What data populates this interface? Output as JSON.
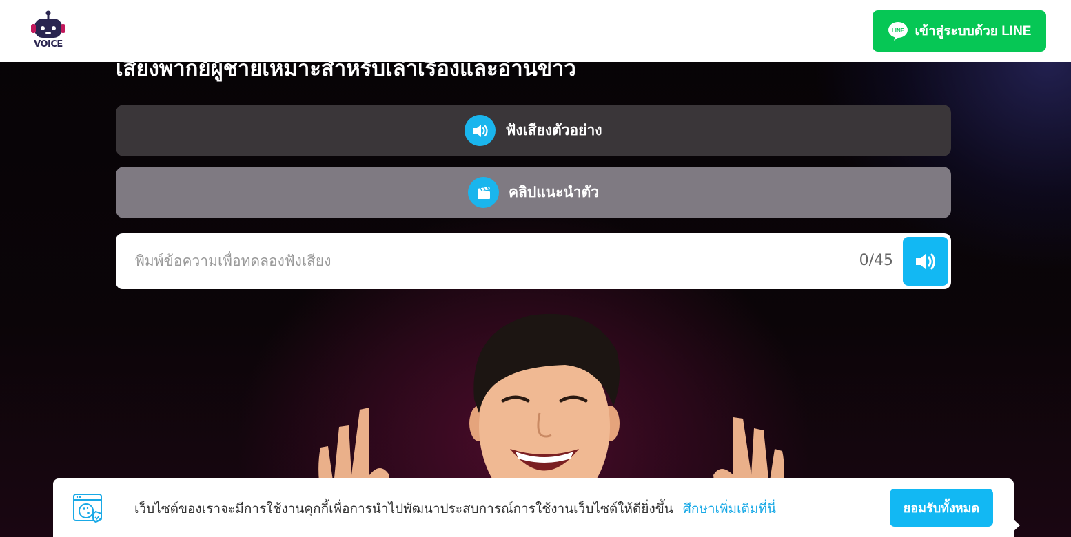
{
  "header": {
    "logo_text": "VOICE",
    "login_button_label": "เข้าสู่ระบบด้วย LINE",
    "line_icon_text": "LINE"
  },
  "main": {
    "title": "เสียงพากย์ผู้ชายเหมาะสำหรับเล่าเรื่องและอ่านข่าว",
    "sample_button_label": "ฟังเสียงตัวอย่าง",
    "clip_button_label": "คลิปแนะนำตัว",
    "try_input": {
      "placeholder": "พิมพ์ข้อความเพื่อทดลองฟังเสียง",
      "value": "",
      "counter": "0/45"
    }
  },
  "cookie_banner": {
    "message": "เว็บไซต์ของเราจะมีการใช้งานคุกกี้เพื่อการนำไปพัฒนาประสบการณ์การใช้งานเว็บไซต์ให้ดียิ่งขึ้น",
    "link_label": "ศึกษาเพิ่มเติมที่นี่",
    "accept_label": "ยอมรับทั้งหมด"
  },
  "colors": {
    "line_green": "#06c755",
    "accent_blue": "#12b8f3",
    "sample_bar": "#3a3639",
    "clip_bar": "#7f7a82"
  },
  "icons": {
    "logo": "robot-headset-icon",
    "login": "line-chat-icon",
    "sample": "speaker-icon",
    "clip": "clapperboard-icon",
    "play": "speaker-icon",
    "cookie": "cookie-browser-icon"
  }
}
